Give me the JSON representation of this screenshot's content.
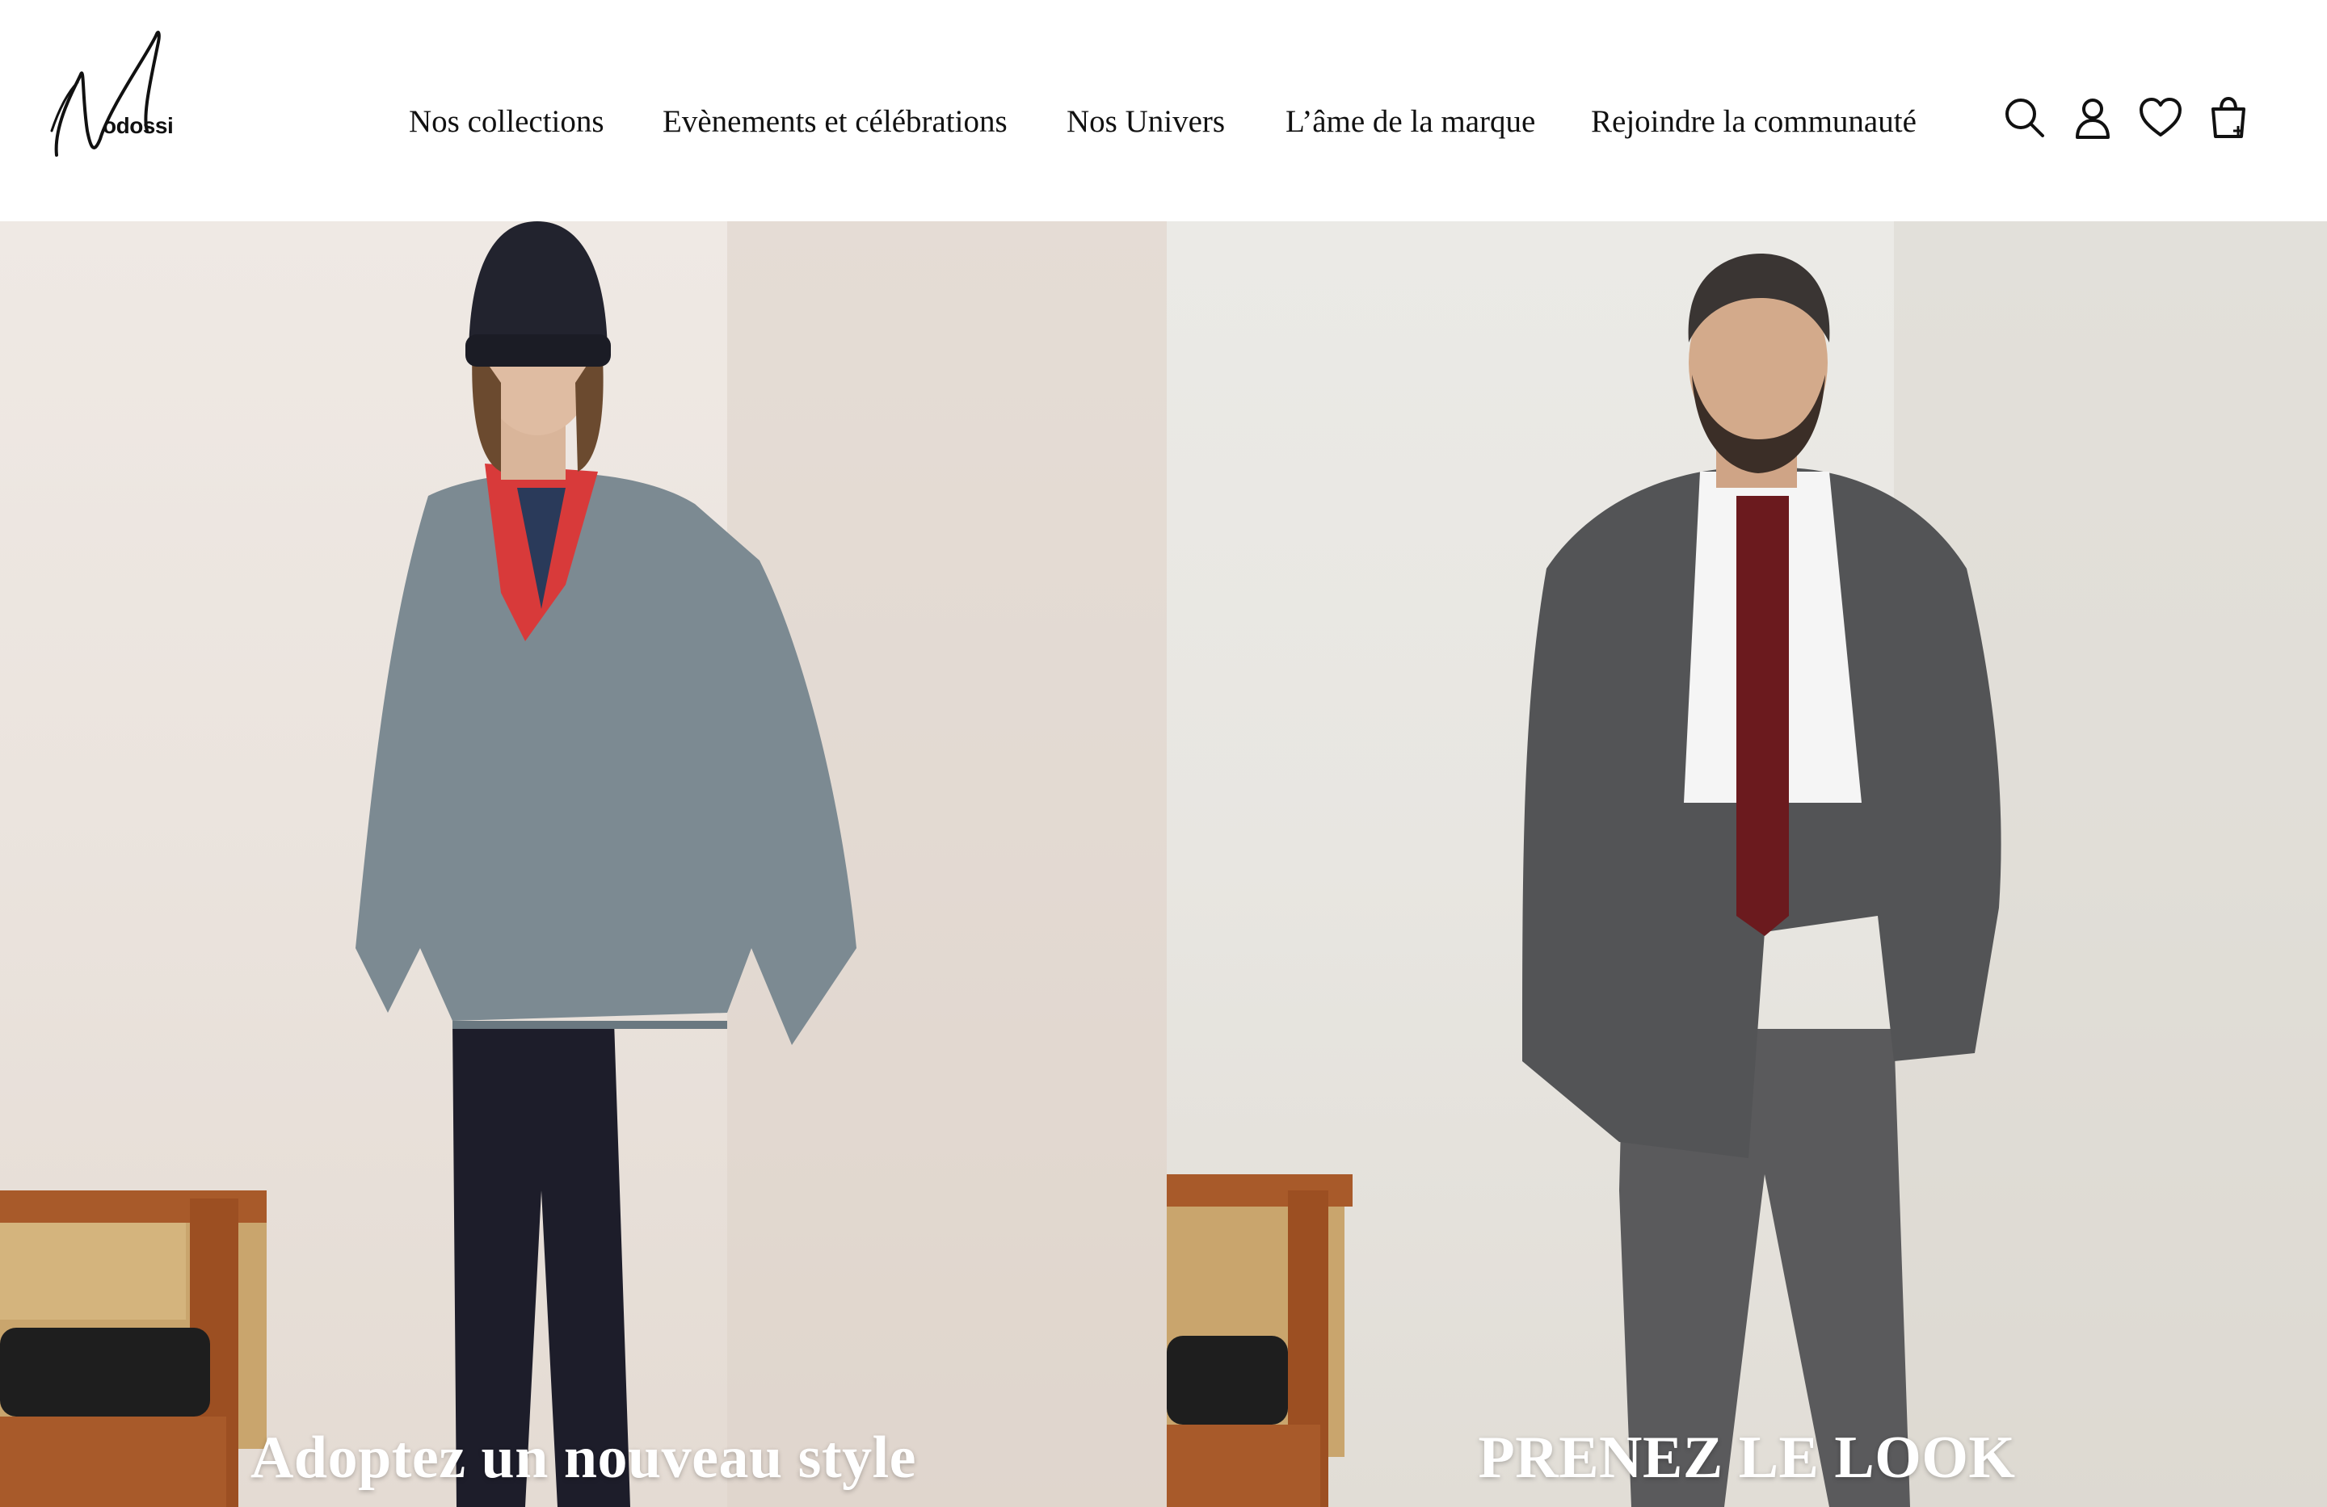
{
  "brand": {
    "name": "odossi",
    "logo_icon": "signature-n-logo"
  },
  "nav": {
    "items": [
      {
        "label": "Nos collections"
      },
      {
        "label": "Evènements et célébrations"
      },
      {
        "label": "Nos Univers"
      },
      {
        "label": "L’âme de la marque"
      },
      {
        "label": "Rejoindre la communauté"
      }
    ]
  },
  "header_icons": [
    "search-icon",
    "account-icon",
    "wishlist-heart-icon",
    "cart-bag-icon"
  ],
  "hero": {
    "left": {
      "caption": "Adoptez un nouveau style"
    },
    "right": {
      "caption": "PRENEZ LE LOOK"
    }
  },
  "colors": {
    "text": "#111111",
    "caption": "#ffffff",
    "background": "#ffffff"
  }
}
